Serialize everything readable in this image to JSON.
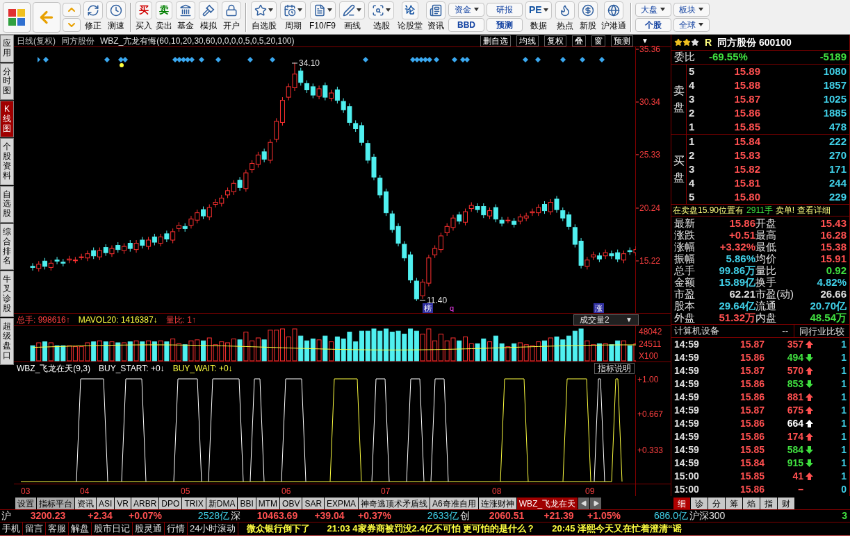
{
  "toolbar": [
    {
      "kind": "big"
    },
    {
      "kind": "big"
    },
    {
      "kind": "updown"
    },
    {
      "kind": "tool",
      "label": "修正",
      "dropdown": false
    },
    {
      "kind": "tool",
      "label": "测速",
      "dropdown": false
    },
    {
      "kind": "sep"
    },
    {
      "kind": "tool",
      "label": "买入",
      "dropdown": false,
      "glyph": "买",
      "color": "#d00000"
    },
    {
      "kind": "tool",
      "label": "卖出",
      "dropdown": false,
      "glyph": "卖",
      "color": "#008000"
    },
    {
      "kind": "tool",
      "label": "基金",
      "dropdown": false
    },
    {
      "kind": "tool",
      "label": "模拟",
      "dropdown": false
    },
    {
      "kind": "tool",
      "label": "开户",
      "dropdown": false
    },
    {
      "kind": "sep"
    },
    {
      "kind": "tool",
      "label": "自选股",
      "dropdown": true
    },
    {
      "kind": "tool",
      "label": "周期",
      "dropdown": true
    },
    {
      "kind": "tool",
      "label": "F10/F9",
      "dropdown": true
    },
    {
      "kind": "tool",
      "label": "画线",
      "dropdown": true
    },
    {
      "kind": "tool",
      "label": "选股",
      "dropdown": true
    },
    {
      "kind": "tool",
      "label": "论股堂",
      "dropdown": false,
      "glyph": "论",
      "color": "#1050a0"
    },
    {
      "kind": "tool",
      "label": "资讯",
      "dropdown": false
    },
    {
      "kind": "pair",
      "top": {
        "label": "资金",
        "dropdown": true
      },
      "bottom": {
        "label": "BBD",
        "dropdown": false
      }
    },
    {
      "kind": "pair",
      "top": {
        "label": "研报",
        "dropdown": false
      },
      "bottom": {
        "label": "预测",
        "dropdown": false
      }
    },
    {
      "kind": "tool",
      "label": "数据",
      "dropdown": true,
      "glyph": "PE",
      "color": "#1050a0"
    },
    {
      "kind": "tool",
      "label": "热点",
      "dropdown": false
    },
    {
      "kind": "tool",
      "label": "新股",
      "dropdown": false
    },
    {
      "kind": "tool",
      "label": "沪港通",
      "dropdown": false
    },
    {
      "kind": "sep"
    },
    {
      "kind": "pair",
      "top": {
        "label": "大盘",
        "dropdown": true
      },
      "bottom": {
        "label": "个股",
        "dropdown": false
      }
    },
    {
      "kind": "pair",
      "top": {
        "label": "板块",
        "dropdown": true
      },
      "bottom": {
        "label": "全球",
        "dropdown": true
      }
    }
  ],
  "side_tabs": [
    {
      "label": "应用",
      "selected": false
    },
    {
      "label": "分时图",
      "selected": false
    },
    {
      "label": "K线图",
      "selected": true
    },
    {
      "label": "个股资料",
      "selected": false
    },
    {
      "label": "自选股",
      "selected": false
    },
    {
      "label": "综合排名",
      "selected": false
    },
    {
      "label": "牛叉诊股",
      "selected": false
    },
    {
      "label": "超级盘口",
      "selected": false
    }
  ],
  "price_pane": {
    "title": "日线(复权)",
    "stock": "同方股份",
    "formula": "WBZ_亢龙有悔(60,10,20,30,60,0,0,0,0,5,0,5,20,100)",
    "buttons": [
      "删自选",
      "均线",
      "复权",
      "叠",
      "窗",
      "预测"
    ],
    "menu": "▼",
    "high": "34.10",
    "low": "11.40",
    "tags": [
      {
        "text": "榜",
        "kind": "box"
      },
      {
        "text": "q",
        "kind": "plain"
      },
      {
        "text": "涨",
        "kind": "box"
      }
    ],
    "chart_data": {
      "type": "candlestick",
      "ylim": [
        10.2,
        35.56
      ],
      "yticks": [
        35.36,
        30.34,
        25.33,
        20.24,
        15.22
      ],
      "ohlc": [
        [
          14.7,
          15.0,
          14.3,
          14.6
        ],
        [
          14.5,
          15.2,
          14.2,
          14.9
        ],
        [
          15.2,
          15.5,
          14.4,
          14.7
        ],
        [
          14.6,
          15.3,
          14.3,
          15.0
        ],
        [
          15.3,
          15.6,
          14.9,
          15.2
        ],
        [
          15.1,
          15.4,
          14.7,
          15.0
        ],
        [
          15.3,
          15.7,
          15.0,
          15.4
        ],
        [
          15.3,
          15.6,
          15.0,
          15.3
        ],
        [
          15.6,
          15.9,
          15.3,
          15.6
        ],
        [
          15.5,
          16.2,
          15.2,
          15.9
        ],
        [
          16.2,
          16.5,
          15.4,
          15.7
        ],
        [
          15.6,
          16.5,
          15.3,
          16.2
        ],
        [
          16.5,
          16.8,
          15.7,
          16.0
        ],
        [
          15.9,
          16.7,
          15.6,
          16.4
        ],
        [
          16.7,
          17.0,
          16.0,
          16.3
        ],
        [
          16.2,
          16.9,
          15.9,
          16.6
        ],
        [
          16.9,
          17.2,
          16.1,
          16.4
        ],
        [
          16.3,
          17.2,
          16.0,
          16.9
        ],
        [
          17.2,
          17.5,
          16.4,
          16.7
        ],
        [
          16.6,
          17.5,
          16.3,
          17.2
        ],
        [
          17.5,
          17.8,
          16.7,
          17.0
        ],
        [
          16.9,
          17.8,
          16.6,
          17.5
        ],
        [
          17.8,
          18.1,
          17.0,
          17.3
        ],
        [
          17.2,
          18.3,
          16.9,
          18.0
        ],
        [
          18.3,
          18.9,
          18.0,
          18.6
        ],
        [
          18.5,
          18.8,
          18.0,
          18.3
        ],
        [
          18.6,
          19.5,
          18.3,
          19.2
        ],
        [
          19.1,
          20.1,
          18.8,
          19.8
        ],
        [
          20.1,
          20.4,
          19.2,
          19.5
        ],
        [
          19.4,
          20.6,
          19.1,
          20.3
        ],
        [
          20.6,
          21.1,
          20.3,
          20.8
        ],
        [
          20.7,
          21.5,
          20.4,
          21.2
        ],
        [
          21.5,
          22.2,
          21.2,
          21.9
        ],
        [
          21.8,
          22.9,
          21.5,
          22.6
        ],
        [
          22.9,
          23.2,
          21.9,
          22.2
        ],
        [
          22.1,
          23.9,
          21.8,
          23.6
        ],
        [
          23.9,
          24.8,
          23.6,
          24.5
        ],
        [
          24.4,
          25.6,
          24.1,
          25.3
        ],
        [
          25.6,
          25.9,
          24.6,
          24.9
        ],
        [
          24.8,
          26.8,
          24.5,
          26.5
        ],
        [
          26.8,
          28.8,
          26.5,
          28.5
        ],
        [
          28.4,
          30.8,
          28.1,
          30.5
        ],
        [
          30.8,
          32.1,
          30.5,
          31.8
        ],
        [
          31.7,
          34.1,
          31.4,
          33.0
        ],
        [
          33.3,
          33.6,
          31.9,
          32.2
        ],
        [
          32.1,
          32.4,
          31.2,
          31.5
        ],
        [
          31.8,
          32.1,
          30.7,
          31.0
        ],
        [
          30.9,
          31.9,
          30.6,
          31.6
        ],
        [
          31.9,
          32.2,
          30.5,
          30.8
        ],
        [
          30.7,
          31.5,
          30.4,
          31.2
        ],
        [
          31.5,
          31.8,
          30.2,
          30.5
        ],
        [
          30.4,
          30.7,
          29.3,
          29.6
        ],
        [
          29.9,
          30.2,
          28.1,
          28.4
        ],
        [
          28.3,
          28.6,
          27.5,
          27.8
        ],
        [
          28.1,
          28.4,
          26.2,
          26.5
        ],
        [
          26.4,
          26.7,
          24.5,
          24.8
        ],
        [
          25.1,
          25.4,
          22.9,
          23.2
        ],
        [
          23.1,
          23.4,
          21.2,
          21.5
        ],
        [
          21.8,
          22.1,
          19.5,
          19.8
        ],
        [
          19.7,
          20.0,
          17.9,
          18.2
        ],
        [
          18.5,
          18.8,
          16.6,
          16.9
        ],
        [
          16.8,
          17.1,
          15.2,
          15.5
        ],
        [
          15.8,
          16.1,
          13.1,
          13.4
        ],
        [
          13.3,
          13.6,
          11.4,
          11.6
        ],
        [
          11.9,
          13.5,
          11.6,
          13.2
        ],
        [
          13.1,
          15.8,
          12.8,
          15.5
        ],
        [
          15.8,
          16.7,
          15.5,
          16.4
        ],
        [
          16.3,
          17.9,
          16.0,
          17.6
        ],
        [
          17.9,
          18.8,
          17.6,
          18.5
        ],
        [
          18.4,
          19.6,
          18.1,
          19.3
        ],
        [
          19.6,
          19.9,
          18.7,
          19.0
        ],
        [
          18.9,
          20.2,
          18.6,
          19.9
        ],
        [
          20.2,
          20.8,
          19.9,
          20.5
        ],
        [
          20.4,
          20.7,
          19.8,
          20.1
        ],
        [
          20.4,
          20.7,
          19.3,
          19.6
        ],
        [
          19.5,
          20.3,
          19.2,
          20.0
        ],
        [
          20.3,
          20.6,
          18.9,
          19.2
        ],
        [
          19.1,
          19.4,
          18.5,
          18.8
        ],
        [
          19.1,
          19.4,
          18.8,
          19.1
        ],
        [
          19.0,
          19.3,
          18.4,
          18.7
        ],
        [
          19.0,
          19.7,
          18.7,
          19.4
        ],
        [
          19.3,
          19.8,
          19.0,
          19.5
        ],
        [
          19.8,
          20.2,
          19.5,
          19.9
        ],
        [
          19.8,
          20.6,
          19.5,
          20.3
        ],
        [
          20.6,
          20.9,
          19.7,
          20.0
        ],
        [
          19.9,
          21.1,
          19.6,
          20.8
        ],
        [
          21.1,
          21.4,
          19.8,
          20.1
        ],
        [
          20.0,
          20.3,
          19.0,
          19.3
        ],
        [
          19.6,
          19.9,
          18.2,
          18.5
        ],
        [
          18.4,
          18.7,
          16.5,
          16.8
        ],
        [
          17.1,
          17.4,
          14.5,
          14.8
        ],
        [
          14.7,
          15.6,
          14.4,
          15.3
        ],
        [
          15.6,
          16.1,
          15.3,
          15.8
        ],
        [
          15.7,
          16.0,
          15.1,
          15.4
        ],
        [
          15.7,
          16.3,
          15.4,
          16.0
        ],
        [
          15.9,
          16.2,
          15.4,
          15.7
        ],
        [
          16.0,
          16.3,
          15.1,
          15.4
        ],
        [
          15.3,
          16.2,
          15.0,
          15.9
        ],
        [
          16.2,
          16.5,
          15.8,
          16.1
        ],
        [
          16.0,
          16.6,
          15.7,
          16.3
        ]
      ]
    }
  },
  "volume_pane": {
    "stats": [
      {
        "label": "总手:",
        "value": "998616↑",
        "color": "#ff4040"
      },
      {
        "label": "MAVOL20:",
        "value": "1416387↓",
        "color": "#ffff40"
      },
      {
        "label": "量比:",
        "value": "1↑",
        "color": "#ff4040"
      }
    ],
    "selector": "成交量2",
    "selector_menu": "▼",
    "yticks": [
      "48042",
      "24511",
      "X100"
    ]
  },
  "indicator_pane": {
    "name": "WBZ_飞龙在天(9,3)",
    "stats": [
      {
        "label": "BUY_START:",
        "value": "+0↓",
        "color": "#ffffff"
      },
      {
        "label": "BUY_WAIT:",
        "value": "+0↓",
        "color": "#ffff40"
      }
    ],
    "help": "指标说明",
    "yticks": [
      "+1.00",
      "+0.667",
      "+0.333"
    ]
  },
  "x_labels": [
    "03",
    "04",
    "05",
    "06",
    "07",
    "08",
    "09"
  ],
  "quote": {
    "stars": 2,
    "flag": "R",
    "name": "同方股份",
    "code": "600100",
    "ratio": {
      "label": "委比",
      "percent": "-69.55%",
      "diff": "-5189"
    },
    "asks_label": "卖盘",
    "bids_label": "买盘",
    "asks": [
      {
        "level": "5",
        "price": "15.89",
        "vol": "1080"
      },
      {
        "level": "4",
        "price": "15.88",
        "vol": "1857"
      },
      {
        "level": "3",
        "price": "15.87",
        "vol": "1025"
      },
      {
        "level": "2",
        "price": "15.86",
        "vol": "1885"
      },
      {
        "level": "1",
        "price": "15.85",
        "vol": "478"
      }
    ],
    "bids": [
      {
        "level": "1",
        "price": "15.84",
        "vol": "222"
      },
      {
        "level": "2",
        "price": "15.83",
        "vol": "270"
      },
      {
        "level": "3",
        "price": "15.82",
        "vol": "171"
      },
      {
        "level": "4",
        "price": "15.81",
        "vol": "244"
      },
      {
        "level": "5",
        "price": "15.80",
        "vol": "229"
      }
    ],
    "notice": {
      "before": "在卖盘15.90位置有",
      "amount": "2911手",
      "after": "卖单! 查看详细"
    },
    "stats": [
      {
        "label": "最新",
        "value": "15.86",
        "color": "#ff5050"
      },
      {
        "label": "开盘",
        "value": "15.43",
        "color": "#ff5050"
      },
      {
        "label": "涨跌",
        "value": "+0.51",
        "color": "#ff5050"
      },
      {
        "label": "最高",
        "value": "16.28",
        "color": "#ff5050"
      },
      {
        "label": "涨幅",
        "value": "+3.32%",
        "color": "#ff5050"
      },
      {
        "label": "最低",
        "value": "15.38",
        "color": "#ff5050"
      },
      {
        "label": "振幅",
        "value": "5.86%",
        "color": "#40d0e8"
      },
      {
        "label": "均价",
        "value": "15.91",
        "color": "#ff5050"
      },
      {
        "label": "总手",
        "value": "99.86万",
        "color": "#40d0e8"
      },
      {
        "label": "量比",
        "value": "0.92",
        "color": "#40e040"
      },
      {
        "label": "金额",
        "value": "15.89亿",
        "color": "#40d0e8"
      },
      {
        "label": "换手",
        "value": "4.82%",
        "color": "#40d0e8"
      },
      {
        "label": "市盈",
        "value": "62.21",
        "color": "#e0e0e0"
      },
      {
        "label": "市盈(动)",
        "value": "26.66",
        "color": "#e0e0e0"
      },
      {
        "label": "股本",
        "value": "29.64亿",
        "color": "#40d0e8"
      },
      {
        "label": "流通",
        "value": "20.70亿",
        "color": "#40d0e8"
      },
      {
        "label": "外盘",
        "value": "51.32万",
        "color": "#ff5050"
      },
      {
        "label": "内盘",
        "value": "48.54万",
        "color": "#40e040"
      }
    ],
    "industry": {
      "name": "计算机设备",
      "dash": "--",
      "compare": "同行业比较"
    },
    "ticks": [
      {
        "time": "14:59",
        "price": "15.87",
        "vol": "357",
        "kind": "buy",
        "count": "1"
      },
      {
        "time": "14:59",
        "price": "15.86",
        "vol": "494",
        "kind": "sell",
        "count": "1"
      },
      {
        "time": "14:59",
        "price": "15.87",
        "vol": "570",
        "kind": "buy",
        "count": "1"
      },
      {
        "time": "14:59",
        "price": "15.86",
        "vol": "853",
        "kind": "sell",
        "count": "1"
      },
      {
        "time": "14:59",
        "price": "15.86",
        "vol": "881",
        "kind": "buy",
        "count": "1"
      },
      {
        "time": "14:59",
        "price": "15.87",
        "vol": "675",
        "kind": "buy",
        "count": "1"
      },
      {
        "time": "14:59",
        "price": "15.86",
        "vol": "664",
        "kind": "big",
        "count": "1"
      },
      {
        "time": "14:59",
        "price": "15.86",
        "vol": "174",
        "kind": "buy",
        "count": "1"
      },
      {
        "time": "14:59",
        "price": "15.85",
        "vol": "584",
        "kind": "sell",
        "count": "1"
      },
      {
        "time": "14:59",
        "price": "15.84",
        "vol": "915",
        "kind": "sell",
        "count": "1"
      },
      {
        "time": "15:00",
        "price": "15.85",
        "vol": "41",
        "kind": "buy",
        "count": "1"
      },
      {
        "time": "15:00",
        "price": "15.86",
        "vol": "–",
        "kind": "none",
        "count": "0"
      }
    ],
    "tabs": [
      {
        "label": "细",
        "selected": true
      },
      {
        "label": "诊",
        "selected": false
      },
      {
        "label": "分",
        "selected": false
      },
      {
        "label": "筹",
        "selected": false
      },
      {
        "label": "焰",
        "selected": false
      },
      {
        "label": "指",
        "selected": false
      },
      {
        "label": "财",
        "selected": false
      }
    ]
  },
  "bottom_tabs": [
    {
      "label": "设置",
      "kind": "plain",
      "selected": false
    },
    {
      "label": "指标平台",
      "kind": "plain",
      "selected": false
    },
    {
      "label": "资讯",
      "kind": "tab",
      "selected": false
    },
    {
      "label": "ASI",
      "kind": "tab",
      "selected": false
    },
    {
      "label": "VR",
      "kind": "tab",
      "selected": false
    },
    {
      "label": "ARBR",
      "kind": "tab",
      "selected": false
    },
    {
      "label": "DPO",
      "kind": "tab",
      "selected": false
    },
    {
      "label": "TRIX",
      "kind": "tab",
      "selected": false
    },
    {
      "label": "新DMA",
      "kind": "tab",
      "selected": false
    },
    {
      "label": "BBI",
      "kind": "tab",
      "selected": false
    },
    {
      "label": "MTM",
      "kind": "tab",
      "selected": false
    },
    {
      "label": "OBV",
      "kind": "tab",
      "selected": false
    },
    {
      "label": "SAR",
      "kind": "tab",
      "selected": false
    },
    {
      "label": "EXPMA",
      "kind": "tab",
      "selected": false
    },
    {
      "label": "神奇逃顶术矛盾线",
      "kind": "tab",
      "selected": false
    },
    {
      "label": "A6奇准自用",
      "kind": "tab",
      "selected": false
    },
    {
      "label": "连涨财神",
      "kind": "tab",
      "selected": false
    },
    {
      "label": "WBZ_飞龙在天",
      "kind": "tab",
      "selected": true
    }
  ],
  "indices": [
    {
      "name": "沪",
      "value": "3200.23",
      "change": "+2.34",
      "percent": "+0.07%",
      "amount": "2528亿"
    },
    {
      "name": "深",
      "value": "10463.69",
      "change": "+39.04",
      "percent": "+0.37%",
      "amount": "2633亿"
    },
    {
      "name": "创",
      "value": "2060.51",
      "change": "+21.39",
      "percent": "+1.05%",
      "amount": "686.0亿"
    }
  ],
  "index_tail": {
    "name": "沪深300",
    "value": "3"
  },
  "news_links": [
    "手机",
    "留言",
    "客服",
    "解盘",
    "股市日记",
    "股灵通",
    "行情",
    "24小时滚动"
  ],
  "headlines": [
    "微众银行倒下了",
    "21:03 4家券商被罚没2.4亿不可怕 更可怕的是什么？",
    "20:45 泽熙今天又在忙着澄清“谣"
  ]
}
